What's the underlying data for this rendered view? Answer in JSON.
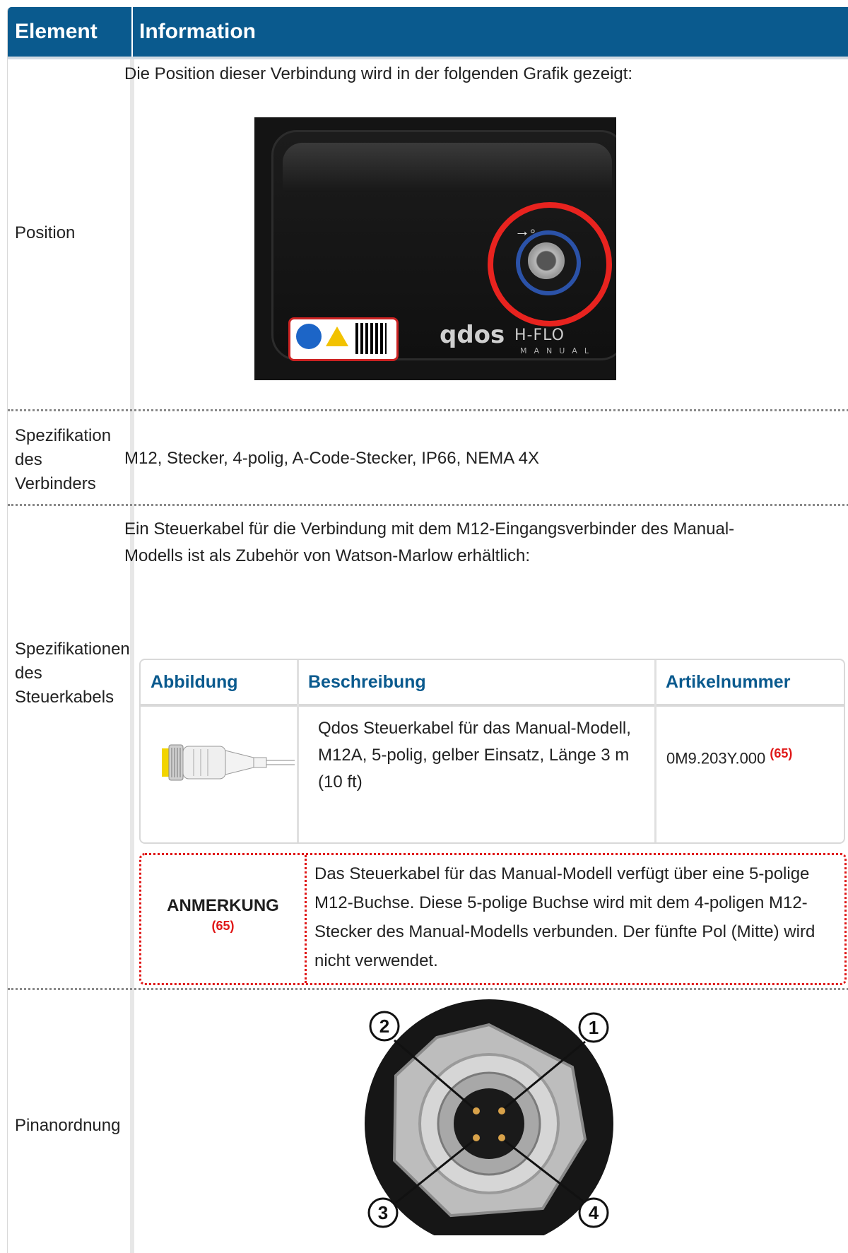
{
  "table": {
    "header": {
      "element": "Element",
      "information": "Information"
    },
    "rows": [
      {
        "label": "Position",
        "text": "Die Position dieser Verbindung wird in der folgenden Grafik gezeigt:"
      },
      {
        "label": "Spezifikation des Verbinders",
        "text": "M12, Stecker, 4-polig, A-Code-Stecker, IP66, NEMA 4X"
      },
      {
        "label": "Spezifikationen des Steuerkabels",
        "text": "Ein Steuerkabel für die Verbindung mit dem M12-Eingangsverbinder des Manual-Modells ist als Zubehör von Watson-Marlow erhältlich:"
      },
      {
        "label": "Pinanordnung"
      }
    ]
  },
  "pump_image": {
    "brand": "qdos",
    "brand_model": "H-FLO",
    "brand_variant": "MANUAL",
    "sticker_url": "wmfts.com/product-documents"
  },
  "accessory_table": {
    "headers": {
      "image": "Abbildung",
      "description": "Beschreibung",
      "part": "Artikelnummer"
    },
    "row": {
      "description": "Qdos Steuerkabel für das Manual-Modell, M12A, 5-polig, gelber Einsatz, Länge 3 m (10 ft)",
      "part_number": "0M9.203Y.000",
      "part_ref": "(65)"
    }
  },
  "note": {
    "title": "ANMERKUNG",
    "ref": "(65)",
    "text": "Das Steuerkabel für das Manual-Modell verfügt über eine 5-polige M12-Buchse. Diese 5-polige Buchse wird mit dem 4-poligen M12-Stecker des Manual-Modells verbunden. Der fünfte Pol (Mitte) wird nicht verwendet."
  },
  "pin_image": {
    "pins": [
      "1",
      "2",
      "3",
      "4"
    ]
  },
  "colors": {
    "header_bg": "#0a5a8e",
    "note_border": "#e01818",
    "accent_text": "#0a5a8e",
    "highlight_ring": "#e8231f"
  }
}
